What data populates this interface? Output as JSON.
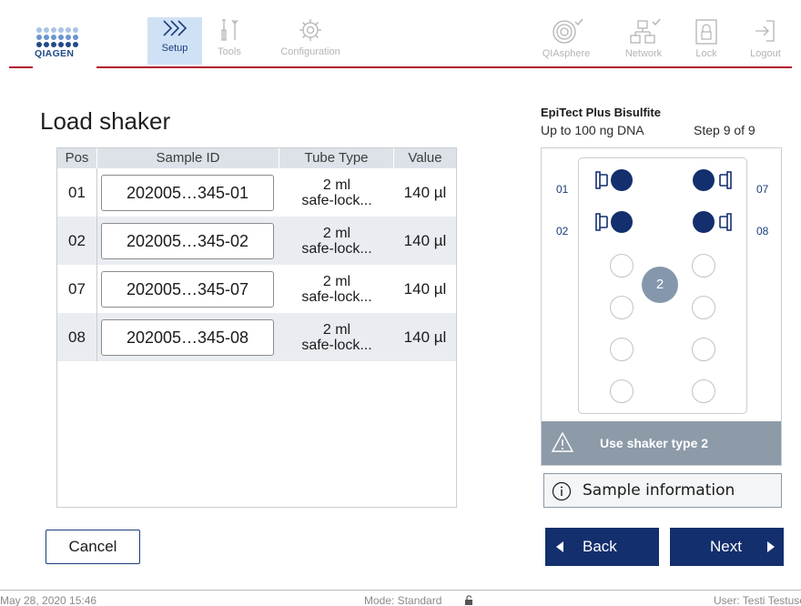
{
  "brand": {
    "logo_text": "QIAGEN"
  },
  "nav": {
    "left": [
      {
        "label": "Setup",
        "icon": "chevrons-icon",
        "active": true
      },
      {
        "label": "Tools",
        "icon": "tools-icon",
        "active": false
      },
      {
        "label": "Configuration",
        "icon": "gear-icon",
        "active": false
      }
    ],
    "right": [
      {
        "label": "QIAsphere",
        "icon": "qiasphere-icon"
      },
      {
        "label": "Network",
        "icon": "network-icon"
      },
      {
        "label": "Lock",
        "icon": "lock-icon"
      },
      {
        "label": "Logout",
        "icon": "logout-icon"
      }
    ]
  },
  "page": {
    "title": "Load shaker"
  },
  "table": {
    "headers": {
      "pos": "Pos",
      "sample_id": "Sample ID",
      "tube_type": "Tube Type",
      "value": "Value"
    },
    "rows": [
      {
        "pos": "01",
        "sample_id": "202005…345-01",
        "tube_line1": "2 ml",
        "tube_line2": "safe-lock...",
        "value": "140 µl"
      },
      {
        "pos": "02",
        "sample_id": "202005…345-02",
        "tube_line1": "2 ml",
        "tube_line2": "safe-lock...",
        "value": "140 µl"
      },
      {
        "pos": "07",
        "sample_id": "202005…345-07",
        "tube_line1": "2 ml",
        "tube_line2": "safe-lock...",
        "value": "140 µl"
      },
      {
        "pos": "08",
        "sample_id": "202005…345-08",
        "tube_line1": "2 ml",
        "tube_line2": "safe-lock...",
        "value": "140 µl"
      }
    ]
  },
  "protocol": {
    "name": "EpiTect Plus Bisulfite",
    "subtitle": "Up to 100 ng DNA",
    "step": "Step 9 of 9"
  },
  "shaker": {
    "labels": {
      "p01": "01",
      "p02": "02",
      "p07": "07",
      "p08": "08"
    },
    "badge": "2",
    "warning": "Use shaker type 2"
  },
  "buttons": {
    "cancel": "Cancel",
    "sample_info": "Sample information",
    "back": "Back",
    "next": "Next"
  },
  "footer": {
    "datetime": "May 28, 2020  15:46",
    "mode": "Mode: Standard",
    "user": "User: Testi Testuser"
  },
  "colors": {
    "brand_red": "#b20d2b",
    "navy": "#132f6e",
    "active_tab": "#cfe1f5",
    "warn_gray": "#8d9aa8"
  }
}
